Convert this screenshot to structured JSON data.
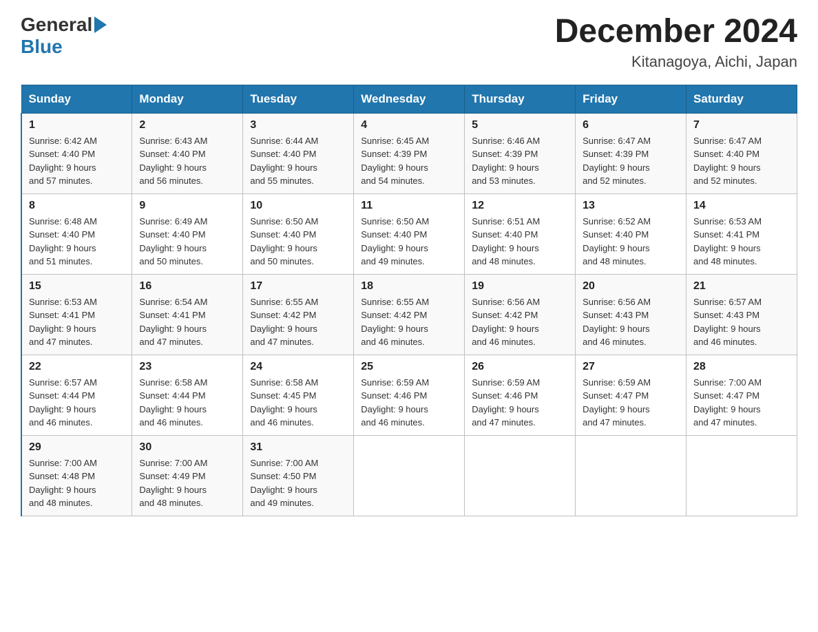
{
  "header": {
    "logo_general": "General",
    "logo_blue": "Blue",
    "title": "December 2024",
    "subtitle": "Kitanagoya, Aichi, Japan"
  },
  "columns": [
    "Sunday",
    "Monday",
    "Tuesday",
    "Wednesday",
    "Thursday",
    "Friday",
    "Saturday"
  ],
  "weeks": [
    [
      {
        "num": "1",
        "sunrise": "6:42 AM",
        "sunset": "4:40 PM",
        "daylight": "9 hours and 57 minutes."
      },
      {
        "num": "2",
        "sunrise": "6:43 AM",
        "sunset": "4:40 PM",
        "daylight": "9 hours and 56 minutes."
      },
      {
        "num": "3",
        "sunrise": "6:44 AM",
        "sunset": "4:40 PM",
        "daylight": "9 hours and 55 minutes."
      },
      {
        "num": "4",
        "sunrise": "6:45 AM",
        "sunset": "4:39 PM",
        "daylight": "9 hours and 54 minutes."
      },
      {
        "num": "5",
        "sunrise": "6:46 AM",
        "sunset": "4:39 PM",
        "daylight": "9 hours and 53 minutes."
      },
      {
        "num": "6",
        "sunrise": "6:47 AM",
        "sunset": "4:39 PM",
        "daylight": "9 hours and 52 minutes."
      },
      {
        "num": "7",
        "sunrise": "6:47 AM",
        "sunset": "4:40 PM",
        "daylight": "9 hours and 52 minutes."
      }
    ],
    [
      {
        "num": "8",
        "sunrise": "6:48 AM",
        "sunset": "4:40 PM",
        "daylight": "9 hours and 51 minutes."
      },
      {
        "num": "9",
        "sunrise": "6:49 AM",
        "sunset": "4:40 PM",
        "daylight": "9 hours and 50 minutes."
      },
      {
        "num": "10",
        "sunrise": "6:50 AM",
        "sunset": "4:40 PM",
        "daylight": "9 hours and 50 minutes."
      },
      {
        "num": "11",
        "sunrise": "6:50 AM",
        "sunset": "4:40 PM",
        "daylight": "9 hours and 49 minutes."
      },
      {
        "num": "12",
        "sunrise": "6:51 AM",
        "sunset": "4:40 PM",
        "daylight": "9 hours and 48 minutes."
      },
      {
        "num": "13",
        "sunrise": "6:52 AM",
        "sunset": "4:40 PM",
        "daylight": "9 hours and 48 minutes."
      },
      {
        "num": "14",
        "sunrise": "6:53 AM",
        "sunset": "4:41 PM",
        "daylight": "9 hours and 48 minutes."
      }
    ],
    [
      {
        "num": "15",
        "sunrise": "6:53 AM",
        "sunset": "4:41 PM",
        "daylight": "9 hours and 47 minutes."
      },
      {
        "num": "16",
        "sunrise": "6:54 AM",
        "sunset": "4:41 PM",
        "daylight": "9 hours and 47 minutes."
      },
      {
        "num": "17",
        "sunrise": "6:55 AM",
        "sunset": "4:42 PM",
        "daylight": "9 hours and 47 minutes."
      },
      {
        "num": "18",
        "sunrise": "6:55 AM",
        "sunset": "4:42 PM",
        "daylight": "9 hours and 46 minutes."
      },
      {
        "num": "19",
        "sunrise": "6:56 AM",
        "sunset": "4:42 PM",
        "daylight": "9 hours and 46 minutes."
      },
      {
        "num": "20",
        "sunrise": "6:56 AM",
        "sunset": "4:43 PM",
        "daylight": "9 hours and 46 minutes."
      },
      {
        "num": "21",
        "sunrise": "6:57 AM",
        "sunset": "4:43 PM",
        "daylight": "9 hours and 46 minutes."
      }
    ],
    [
      {
        "num": "22",
        "sunrise": "6:57 AM",
        "sunset": "4:44 PM",
        "daylight": "9 hours and 46 minutes."
      },
      {
        "num": "23",
        "sunrise": "6:58 AM",
        "sunset": "4:44 PM",
        "daylight": "9 hours and 46 minutes."
      },
      {
        "num": "24",
        "sunrise": "6:58 AM",
        "sunset": "4:45 PM",
        "daylight": "9 hours and 46 minutes."
      },
      {
        "num": "25",
        "sunrise": "6:59 AM",
        "sunset": "4:46 PM",
        "daylight": "9 hours and 46 minutes."
      },
      {
        "num": "26",
        "sunrise": "6:59 AM",
        "sunset": "4:46 PM",
        "daylight": "9 hours and 47 minutes."
      },
      {
        "num": "27",
        "sunrise": "6:59 AM",
        "sunset": "4:47 PM",
        "daylight": "9 hours and 47 minutes."
      },
      {
        "num": "28",
        "sunrise": "7:00 AM",
        "sunset": "4:47 PM",
        "daylight": "9 hours and 47 minutes."
      }
    ],
    [
      {
        "num": "29",
        "sunrise": "7:00 AM",
        "sunset": "4:48 PM",
        "daylight": "9 hours and 48 minutes."
      },
      {
        "num": "30",
        "sunrise": "7:00 AM",
        "sunset": "4:49 PM",
        "daylight": "9 hours and 48 minutes."
      },
      {
        "num": "31",
        "sunrise": "7:00 AM",
        "sunset": "4:50 PM",
        "daylight": "9 hours and 49 minutes."
      },
      null,
      null,
      null,
      null
    ]
  ],
  "labels": {
    "sunrise": "Sunrise:",
    "sunset": "Sunset:",
    "daylight": "Daylight:"
  }
}
